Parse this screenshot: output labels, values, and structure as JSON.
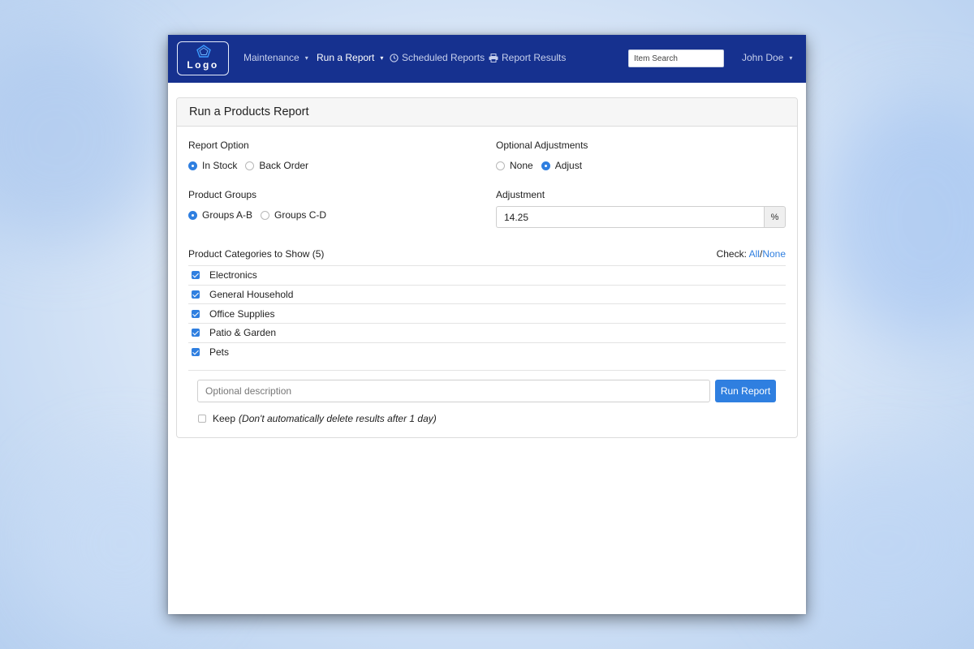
{
  "navbar": {
    "logo_text": "Logo",
    "items": [
      {
        "label": "Maintenance",
        "caret": "▾"
      },
      {
        "label": "Run a Report",
        "caret": "▾"
      },
      {
        "label": "Scheduled Reports",
        "icon": "clock-icon"
      },
      {
        "label": "Report Results",
        "icon": "printer-icon"
      }
    ],
    "search_placeholder": "Item Search",
    "user": "John Doe",
    "user_caret": "▾"
  },
  "card": {
    "title": "Run a Products Report",
    "report_option": {
      "label": "Report Option",
      "options": [
        "In Stock",
        "Back Order"
      ],
      "selected": "In Stock"
    },
    "optional_adjustments": {
      "label": "Optional Adjustments",
      "options": [
        "None",
        "Adjust"
      ],
      "selected": "Adjust"
    },
    "product_groups": {
      "label": "Product Groups",
      "options": [
        "Groups A-B",
        "Groups C-D"
      ],
      "selected": "Groups A-B"
    },
    "adjustment": {
      "label": "Adjustment",
      "value": "14.25",
      "unit": "%"
    },
    "categories": {
      "label": "Product Categories to Show (5)",
      "check_label": "Check:",
      "check_all": "All",
      "check_separator": "/",
      "check_none": "None",
      "items": [
        {
          "label": "Electronics",
          "checked": true
        },
        {
          "label": "General Household",
          "checked": true
        },
        {
          "label": "Office Supplies",
          "checked": true
        },
        {
          "label": "Patio & Garden",
          "checked": true
        },
        {
          "label": "Pets",
          "checked": true
        }
      ]
    },
    "description_placeholder": "Optional description",
    "run_button": "Run Report",
    "keep": {
      "label": "Keep",
      "note": "(Don't automatically delete results after 1 day)",
      "checked": false
    }
  },
  "colors": {
    "navbar_bg": "#16318f",
    "accent": "#2f7fe0"
  }
}
